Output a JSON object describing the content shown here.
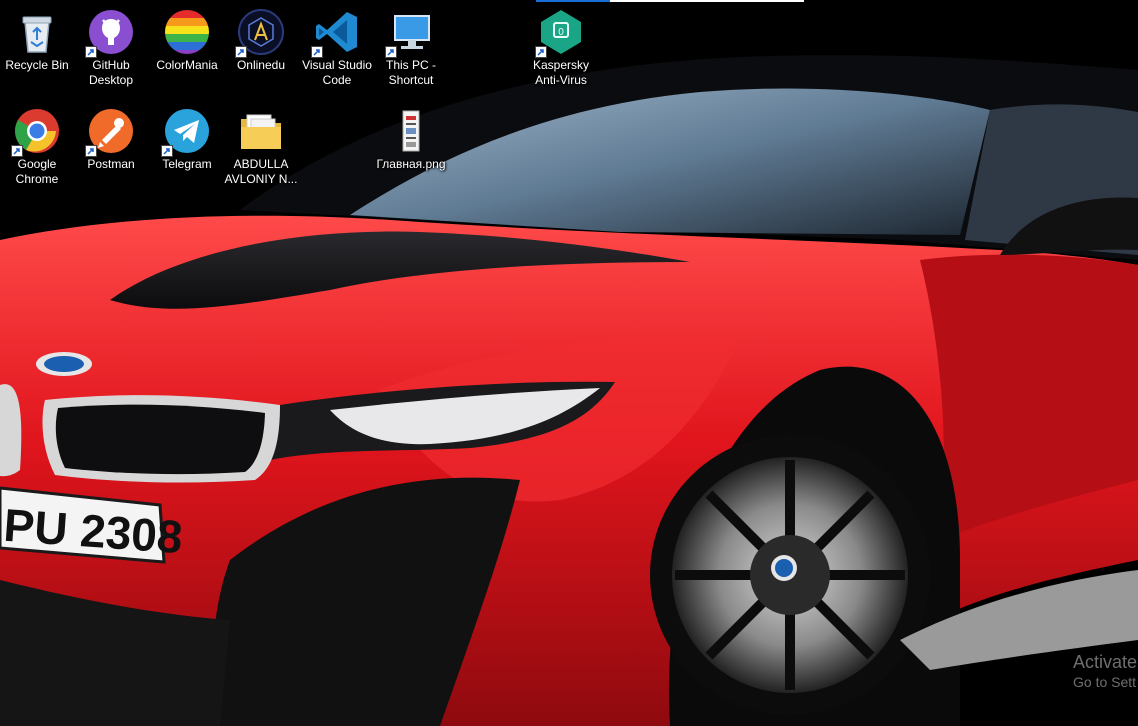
{
  "desktop": {
    "icons": [
      {
        "label": "Recycle Bin",
        "icon": "recycle-bin-icon"
      },
      {
        "label": "GitHub\nDesktop",
        "icon": "github-desktop-icon"
      },
      {
        "label": "ColorMania",
        "icon": "colormania-icon"
      },
      {
        "label": "Onlinedu",
        "icon": "onlinedu-icon"
      },
      {
        "label": "Visual Studio\nCode",
        "icon": "vscode-icon"
      },
      {
        "label": "This PC -\nShortcut",
        "icon": "this-pc-icon"
      },
      {
        "label": "Kaspersky\nAnti-Virus",
        "icon": "kaspersky-icon"
      },
      {
        "label": "Google\nChrome",
        "icon": "chrome-icon"
      },
      {
        "label": "Postman",
        "icon": "postman-icon"
      },
      {
        "label": "Telegram",
        "icon": "telegram-icon"
      },
      {
        "label": "ABDULLA\nAVLONIY N...",
        "icon": "folder-icon"
      },
      {
        "label": "Главная.png",
        "icon": "png-file-icon"
      }
    ]
  },
  "wallpaper": {
    "plate_text": "PU 2308",
    "car_color": "#d8141c"
  },
  "watermark": {
    "line1": "Activate",
    "line2": "Go to Sett"
  }
}
